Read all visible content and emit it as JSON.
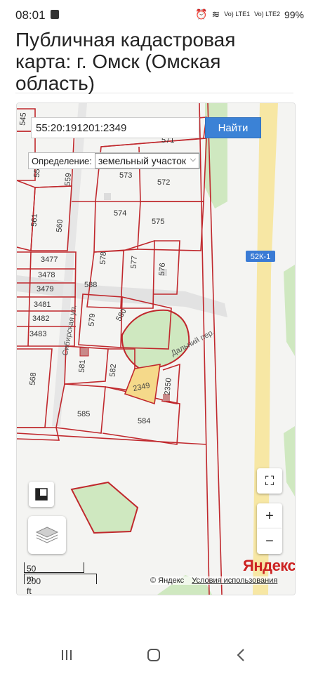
{
  "status_bar": {
    "time": "08:01",
    "battery": "99%",
    "lte1": "Vo) LTE1",
    "lte2": "Vo) LTE2"
  },
  "page": {
    "title": "Публичная кадастровая карта: г. Омск (Омская область)"
  },
  "search": {
    "value": "55:20:191201:2349",
    "button": "Найти"
  },
  "definition": {
    "label": "Определение:",
    "selected": "земельный участок"
  },
  "map": {
    "road_label": "52К-1",
    "street_1": "Сибирская ул.",
    "street_2": "Дальний пер.",
    "highlight_parcel": "2349",
    "parcels": [
      "545",
      "571",
      "558",
      "559",
      "573",
      "572",
      "561",
      "560",
      "574",
      "575",
      "3477",
      "578",
      "577",
      "576",
      "3478",
      "3479",
      "3481",
      "3482",
      "3483",
      "588",
      "579",
      "580",
      "568",
      "581",
      "582",
      "2350",
      "585",
      "584"
    ],
    "accent_color": "#cc2222",
    "highlight_color": "#f5d98a"
  },
  "controls": {
    "fullscreen_icon": "expand-icon",
    "zoom_in": "+",
    "zoom_out": "−",
    "ruler_icon": "ruler-icon",
    "layers_icon": "layers-icon"
  },
  "scale": {
    "meters": "50 m",
    "feet": "200 ft"
  },
  "attribution": {
    "logo": "Яндекс",
    "copyright": "© Яндекс",
    "terms": "Условия использования"
  }
}
